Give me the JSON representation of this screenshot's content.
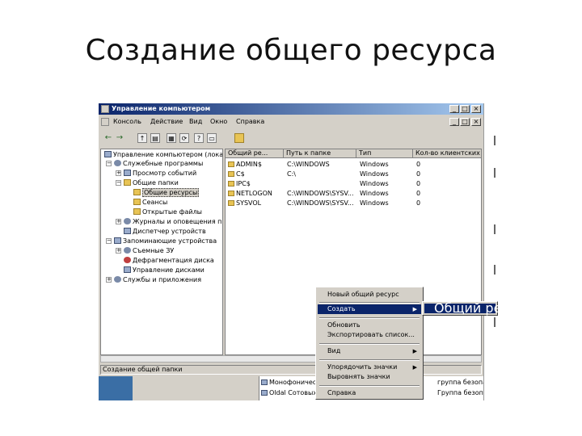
{
  "slide": {
    "title": "Создание общего ресурса"
  },
  "window": {
    "title": "Управление компьютером",
    "controls": {
      "minimize": "_",
      "maximize": "□",
      "close": "×"
    }
  },
  "menu": [
    "Консоль",
    "Действие",
    "Вид",
    "Окно",
    "Справка"
  ],
  "toolbar_icons": [
    "back-arrow-icon",
    "forward-arrow-icon",
    "up-folder-icon",
    "show-tree-icon",
    "properties-icon",
    "refresh-icon",
    "help-icon",
    "new-share-icon"
  ],
  "tree": [
    "Управление компьютером (локальным)",
    "Служебные программы",
    "Просмотр событий",
    "Общие папки",
    "Общие ресурсы",
    "Сеансы",
    "Открытые файлы",
    "Журналы и оповещения производительности",
    "Диспетчер устройств",
    "Запоминающие устройства",
    "Съемные ЗУ",
    "Дефрагментация диска",
    "Управление дисками",
    "Службы и приложения"
  ],
  "list": {
    "headers": [
      "Общий ре...",
      "Путь к папке",
      "Тип",
      "Кол-во клиентских"
    ],
    "rows": [
      [
        "ADMIN$",
        "C:\\WINDOWS",
        "Windows",
        "0"
      ],
      [
        "C$",
        "C:\\",
        "Windows",
        "0"
      ],
      [
        "IPC$",
        "",
        "Windows",
        "0"
      ],
      [
        "NETLOGON",
        "C:\\WINDOWS\\SYSV...",
        "Windows",
        "0"
      ],
      [
        "SYSVOL",
        "C:\\WINDOWS\\SYSV...",
        "Windows",
        "0"
      ]
    ]
  },
  "status": "Создание общей папки",
  "context_menu": {
    "items": [
      "Новый общий ресурс",
      "Создать",
      "Обновить",
      "Экспортировать список...",
      "Вид",
      "Упорядочить значки",
      "Выровнять значки",
      "Справка"
    ],
    "submenu": "Общий ресурс..."
  },
  "background_rows": [
    {
      "name": "Монофонический",
      "group": "группа безопа..."
    },
    {
      "name": "Oldal Сотовых",
      "group": "Группа безопа..."
    }
  ]
}
